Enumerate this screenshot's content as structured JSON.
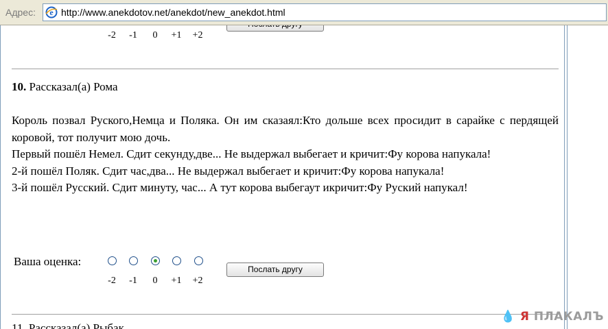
{
  "address_bar": {
    "label": "Адрес:",
    "url": "http://www.anekdotov.net/anekdot/new_anekdot.html"
  },
  "rating_scale": [
    "-2",
    "-1",
    "0",
    "+1",
    "+2"
  ],
  "top_item": {
    "send_button_label": "Послать другу"
  },
  "item": {
    "number": "10.",
    "author_line": " Рассказал(а) Рома",
    "paragraphs": [
      "Король позвал Руского,Немца и Поляка. Он им сказаял:Кто дольше всех просидит в сарайке с пердящей коровой, тот получит мою дочь.",
      "Первый пошёл Немел. Сдит секунду,две... Не выдержал выбегает и кричит:Фу корова напукала!",
      "2-й пошёл Поляк. Сдит час,два... Не выдержал выбегает и кричит:Фу корова напукала!",
      "3-й пошёл Русский. Сдит минуту, час... А тут корова выбегаут икричит:Фу Руский напукал!"
    ],
    "rating_label": "Ваша оценка:",
    "selected_rating": "0",
    "send_button_label": "Послать другу"
  },
  "next_item": {
    "title_partial": "11. Рассказал(а) Рыбак"
  },
  "watermark": {
    "drop": "💧",
    "ya": "Я",
    "rest": " ПЛАКАЛЪ"
  }
}
